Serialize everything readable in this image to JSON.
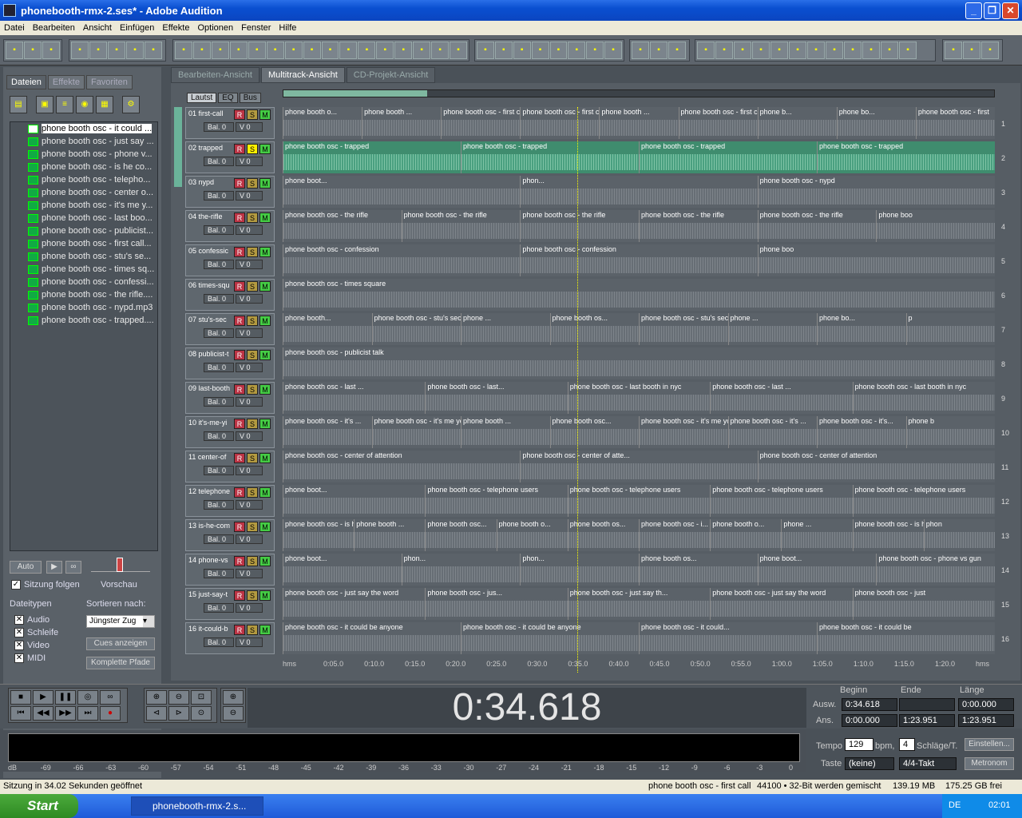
{
  "window": {
    "title": "phonebooth-rmx-2.ses* - Adobe Audition"
  },
  "menu": [
    "Datei",
    "Bearbeiten",
    "Ansicht",
    "Einfügen",
    "Effekte",
    "Optionen",
    "Fenster",
    "Hilfe"
  ],
  "left": {
    "tabs": [
      "Dateien",
      "Effekte",
      "Favoriten"
    ],
    "files": [
      "phone booth osc - it could ...",
      "phone booth osc - just say ...",
      "phone booth osc - phone v...",
      "phone booth osc - is he co...",
      "phone booth osc - telepho...",
      "phone booth osc - center o...",
      "phone booth osc - it's me y...",
      "phone booth osc - last boo...",
      "phone booth osc - publicist...",
      "phone booth osc - first call...",
      "phone booth osc - stu's se...",
      "phone booth osc - times sq...",
      "phone booth osc - confessi...",
      "phone booth osc - the rifle....",
      "phone booth osc - nypd.mp3",
      "phone booth osc - trapped...."
    ],
    "auto": "Auto",
    "follow": "Sitzung folgen",
    "preview": "Vorschau",
    "filetypes_label": "Dateitypen",
    "filetypes": [
      "Audio",
      "Schleife",
      "Video",
      "MIDI"
    ],
    "sort_label": "Sortieren nach:",
    "sort_value": "Jüngster Zug",
    "cues_button": "Cues anzeigen",
    "paths_button": "Komplette Pfade"
  },
  "viewtabs": [
    "Bearbeiten-Ansicht",
    "Multitrack-Ansicht",
    "CD-Projekt-Ansicht"
  ],
  "trackpanel_tabs": [
    "Lautst",
    "EQ",
    "Bus"
  ],
  "tracks": [
    {
      "name": "01 first-call",
      "bal": "Bal. 0",
      "vol": "V 0"
    },
    {
      "name": "02 trapped",
      "bal": "Bal. 0",
      "vol": "V 0"
    },
    {
      "name": "03 nypd",
      "bal": "Bal. 0",
      "vol": "V 0"
    },
    {
      "name": "04 the-rifle",
      "bal": "Bal. 0",
      "vol": "V 0"
    },
    {
      "name": "05 confessic",
      "bal": "Bal. 0",
      "vol": "V 0"
    },
    {
      "name": "06 times-squ",
      "bal": "Bal. 0",
      "vol": "V 0"
    },
    {
      "name": "07 stu's-sec",
      "bal": "Bal. 0",
      "vol": "V 0"
    },
    {
      "name": "08 publicist-t",
      "bal": "Bal. 0",
      "vol": "V 0"
    },
    {
      "name": "09 last-booth",
      "bal": "Bal. 0",
      "vol": "V 0"
    },
    {
      "name": "10 it's-me-yi",
      "bal": "Bal. 0",
      "vol": "V 0"
    },
    {
      "name": "11 center-of",
      "bal": "Bal. 0",
      "vol": "V 0"
    },
    {
      "name": "12 telephone",
      "bal": "Bal. 0",
      "vol": "V 0"
    },
    {
      "name": "13 is-he-com",
      "bal": "Bal. 0",
      "vol": "V 0"
    },
    {
      "name": "14 phone-vs",
      "bal": "Bal. 0",
      "vol": "V 0"
    },
    {
      "name": "15 just-say-t",
      "bal": "Bal. 0",
      "vol": "V 0"
    },
    {
      "name": "16 it-could-b",
      "bal": "Bal. 0",
      "vol": "V 0"
    }
  ],
  "rsm": {
    "R": "R",
    "S": "S",
    "M": "M"
  },
  "clips": [
    [
      "phone booth o...",
      "phone booth ...",
      "phone booth osc - first call",
      "phone booth osc - first call",
      "phone booth ...",
      "phone booth osc - first call",
      "phone b...",
      "phone bo...",
      "phone booth osc - first"
    ],
    [
      "phone booth osc - trapped",
      "phone booth osc - trapped",
      "phone booth osc - trapped",
      "phone booth osc - trapped"
    ],
    [
      "phone boot...",
      "phon...",
      "phone booth osc - nypd"
    ],
    [
      "phone booth osc - the rifle",
      "phone booth osc - the rifle",
      "phone booth osc - the rifle",
      "phone booth osc - the rifle",
      "phone booth osc - the rifle",
      "phone boo"
    ],
    [
      "phone booth osc - confession",
      "phone booth osc - confession",
      "phone boo"
    ],
    [
      "phone booth osc - times square"
    ],
    [
      "phone booth...",
      "phone booth osc - stu's secret",
      "phone ...",
      "phone booth os...",
      "phone booth osc - stu's secret",
      "phone ...",
      "phone bo...",
      "p"
    ],
    [
      "phone booth osc - publicist talk"
    ],
    [
      "phone booth osc - last ...",
      "phone booth osc - last...",
      "phone booth osc - last booth in nyc",
      "phone booth osc - last ...",
      "phone booth osc - last booth in nyc"
    ],
    [
      "phone booth osc - it's ...",
      "phone booth osc - it's me you want",
      "phone booth ...",
      "phone booth osc...",
      "phone booth osc - it's me you...",
      "phone booth osc - it's ...",
      "phone booth osc - it's...",
      "phone b"
    ],
    [
      "phone booth osc - center of attention",
      "phone booth osc - center of atte...",
      "phone booth osc - center of attention"
    ],
    [
      "phone boot...",
      "phone booth osc - telephone users",
      "phone booth osc - telephone users",
      "phone booth osc - telephone users",
      "phone booth osc - telephone users"
    ],
    [
      "phone booth osc - is he coming out",
      "phone booth ...",
      "phone booth osc...",
      "phone booth o...",
      "phone booth os...",
      "phone booth osc - i...",
      "phone booth o...",
      "phone ...",
      "phone booth osc - is he ...",
      "phon"
    ],
    [
      "phone boot...",
      "phon...",
      "phon...",
      "phone booth os...",
      "phone boot...",
      "phone booth osc - phone vs gun"
    ],
    [
      "phone booth osc - just say the word",
      "phone booth osc - jus...",
      "phone booth osc - just say th...",
      "phone booth osc - just say the word",
      "phone booth osc - just"
    ],
    [
      "phone booth osc - it could be anyone",
      "phone booth osc - it could be anyone",
      "phone booth osc - it could...",
      "phone booth osc - it could be"
    ]
  ],
  "lane_numbers": [
    "1",
    "2",
    "3",
    "4",
    "5",
    "6",
    "7",
    "8",
    "9",
    "10",
    "11",
    "12",
    "13",
    "14",
    "15",
    "16"
  ],
  "ruler": [
    "hms",
    "0:05.0",
    "0:10.0",
    "0:15.0",
    "0:20.0",
    "0:25.0",
    "0:30.0",
    "0:35.0",
    "0:40.0",
    "0:45.0",
    "0:50.0",
    "0:55.0",
    "1:00.0",
    "1:05.0",
    "1:10.0",
    "1:15.0",
    "1:20.0",
    "hms"
  ],
  "time": "0:34.618",
  "selection": {
    "h_begin": "Beginn",
    "h_end": "Ende",
    "h_len": "Länge",
    "row1_label": "Ausw.",
    "row1_begin": "0:34.618",
    "row1_end": "",
    "row1_len": "0:00.000",
    "row2_label": "Ans.",
    "row2_begin": "0:00.000",
    "row2_end": "1:23.951",
    "row2_len": "1:23.951"
  },
  "meter_ticks": [
    "dB",
    "-69",
    "-66",
    "-63",
    "-60",
    "-57",
    "-54",
    "-51",
    "-48",
    "-45",
    "-42",
    "-39",
    "-36",
    "-33",
    "-30",
    "-27",
    "-24",
    "-21",
    "-18",
    "-15",
    "-12",
    "-9",
    "-6",
    "-3",
    "0"
  ],
  "tempo": {
    "label": "Tempo",
    "value": "129",
    "bpm": "bpm,",
    "beats": "4",
    "beats_label": "Schläge/T.",
    "settings": "Einstellen...",
    "key_label": "Taste",
    "key_value": "(keine)",
    "meter": "4/4-Takt",
    "metronome": "Metronom"
  },
  "status": {
    "left": "Sitzung in 34.02 Sekunden geöffnet",
    "file": "phone booth osc - first call",
    "format": "44100 • 32-Bit werden gemischt",
    "mem": "139.19 MB",
    "disk": "175.25 GB frei"
  },
  "taskbar": {
    "start": "Start",
    "item": "phonebooth-rmx-2.s...",
    "lang": "DE",
    "clock": "02:01"
  }
}
